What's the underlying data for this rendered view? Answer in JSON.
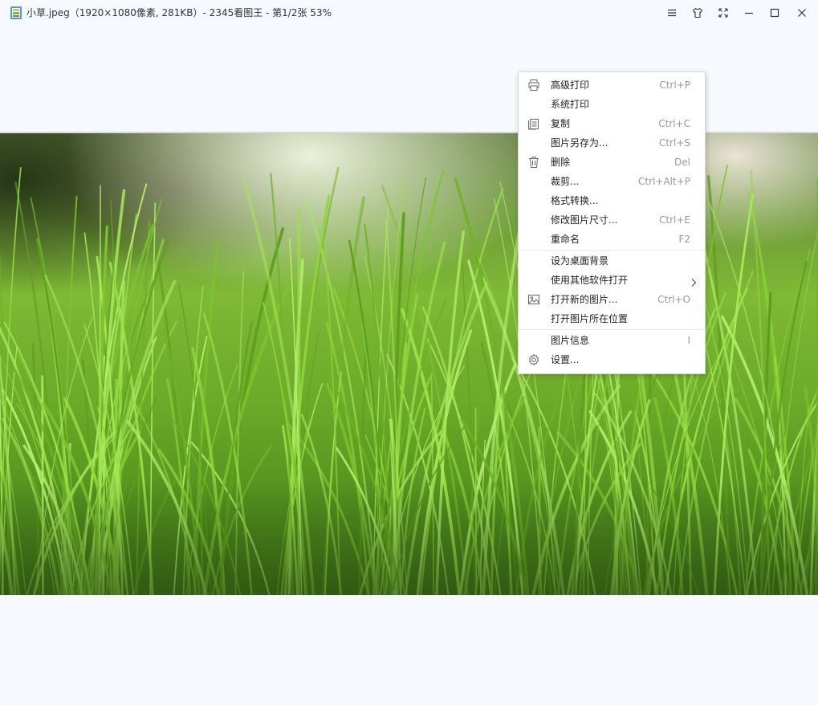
{
  "titlebar": {
    "title": "小草.jpeg（1920×1080像素, 281KB）- 2345看图王 - 第1/2张 53%",
    "app_icon": "picture-app-icon",
    "buttons": [
      "menu-icon",
      "skin-icon",
      "fullscreen-icon",
      "minimize-icon",
      "maximize-icon",
      "close-icon"
    ]
  },
  "image": {
    "description_icon": "grass-photo"
  },
  "context_menu": {
    "items": [
      {
        "label": "高级打印",
        "shortcut": "Ctrl+P",
        "icon": "printer-icon"
      },
      {
        "label": "系统打印",
        "shortcut": "",
        "icon": ""
      },
      {
        "label": "复制",
        "shortcut": "Ctrl+C",
        "icon": "copy-icon"
      },
      {
        "label": "图片另存为...",
        "shortcut": "Ctrl+S",
        "icon": ""
      },
      {
        "label": "删除",
        "shortcut": "Del",
        "icon": "trash-icon"
      },
      {
        "label": "裁剪...",
        "shortcut": "Ctrl+Alt+P",
        "icon": ""
      },
      {
        "label": "格式转换...",
        "shortcut": "",
        "icon": ""
      },
      {
        "label": "修改图片尺寸...",
        "shortcut": "Ctrl+E",
        "icon": ""
      },
      {
        "label": "重命名",
        "shortcut": "F2",
        "icon": ""
      },
      {
        "label": "设为桌面背景",
        "shortcut": "",
        "icon": ""
      },
      {
        "label": "使用其他软件打开",
        "shortcut": "",
        "icon": "chevron-right-icon"
      },
      {
        "label": "打开新的图片...",
        "shortcut": "Ctrl+O",
        "icon": "image-icon"
      },
      {
        "label": "打开图片所在位置",
        "shortcut": "",
        "icon": ""
      },
      {
        "label": "图片信息",
        "shortcut": "I",
        "icon": ""
      },
      {
        "label": "设置...",
        "shortcut": "",
        "icon": "gear-icon"
      }
    ]
  },
  "colors": {
    "background": "#f6f9fd",
    "menu_bg": "#ffffff",
    "grass_light": "#8fd63a",
    "grass_dark": "#2f6b12"
  }
}
